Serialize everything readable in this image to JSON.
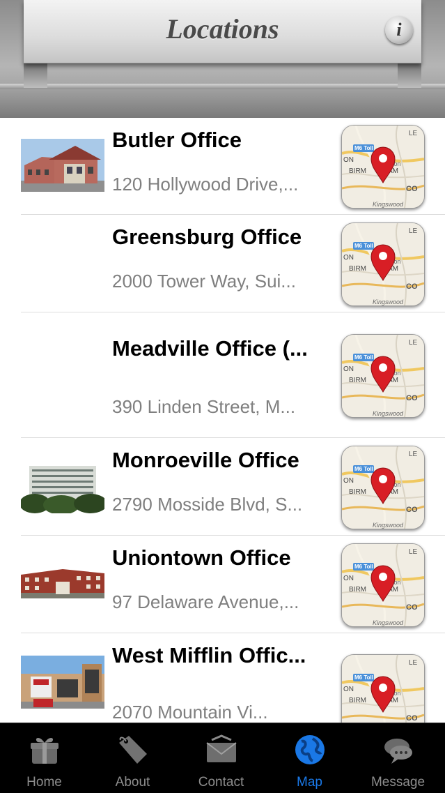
{
  "header": {
    "title": "Locations",
    "info_icon": "info-icon"
  },
  "locations": [
    {
      "name": "Butler Office",
      "address": "120 Hollywood Drive,...",
      "has_photo": true
    },
    {
      "name": "Greensburg Office",
      "address": "2000 Tower Way, Sui...",
      "has_photo": false
    },
    {
      "name": "Meadville Office (...",
      "address": "390 Linden Street, M...",
      "has_photo": false
    },
    {
      "name": "Monroeville Office",
      "address": "2790 Mosside Blvd, S...",
      "has_photo": true
    },
    {
      "name": "Uniontown Office",
      "address": "97 Delaware Avenue,...",
      "has_photo": true
    },
    {
      "name": "West Mifflin Offic...",
      "address": "2070 Mountain Vi...",
      "has_photo": true
    }
  ],
  "map_thumbnail": {
    "labels": [
      "LE",
      "M6 Toll",
      "ON",
      "Nun",
      "ton",
      "BIRM",
      "AM",
      "CO",
      "Kingswood"
    ]
  },
  "tabbar": {
    "tabs": [
      {
        "label": "Home",
        "icon": "gift-box-icon",
        "active": false
      },
      {
        "label": "About",
        "icon": "tag-icon",
        "active": false
      },
      {
        "label": "Contact",
        "icon": "envelope-icon",
        "active": false
      },
      {
        "label": "Map",
        "icon": "globe-icon",
        "active": true
      },
      {
        "label": "Message",
        "icon": "chat-bubbles-icon",
        "active": false
      }
    ]
  },
  "colors": {
    "active_tab": "#1a78e6",
    "inactive_tab": "#8e8e8e",
    "address_text": "#7f7f7f",
    "map_pin": "#d81e25"
  }
}
